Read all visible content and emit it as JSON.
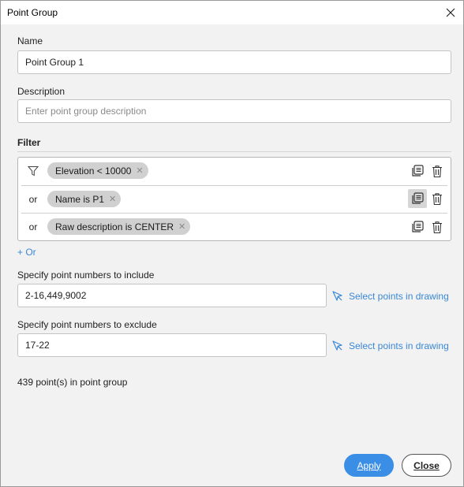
{
  "window": {
    "title": "Point Group"
  },
  "name": {
    "label": "Name",
    "value": "Point Group 1"
  },
  "description": {
    "label": "Description",
    "placeholder": "Enter point group description"
  },
  "filter": {
    "label": "Filter",
    "rows": [
      {
        "prefix": "",
        "chip": "Elevation < 10000"
      },
      {
        "prefix": "or",
        "chip": "Name is P1"
      },
      {
        "prefix": "or",
        "chip": "Raw description is CENTER"
      }
    ],
    "add_or": "+ Or"
  },
  "include": {
    "label": "Specify point numbers to include",
    "value": "2-16,449,9002",
    "select_link": "Select points in drawing"
  },
  "exclude": {
    "label": "Specify point numbers to exclude",
    "value": "17-22",
    "select_link": "Select points in drawing"
  },
  "status": "439 point(s) in point group",
  "buttons": {
    "apply": "Apply",
    "close": "Close"
  },
  "colors": {
    "accent": "#3a8ee6",
    "link": "#3a87d6",
    "chip": "#d0d0d0"
  }
}
